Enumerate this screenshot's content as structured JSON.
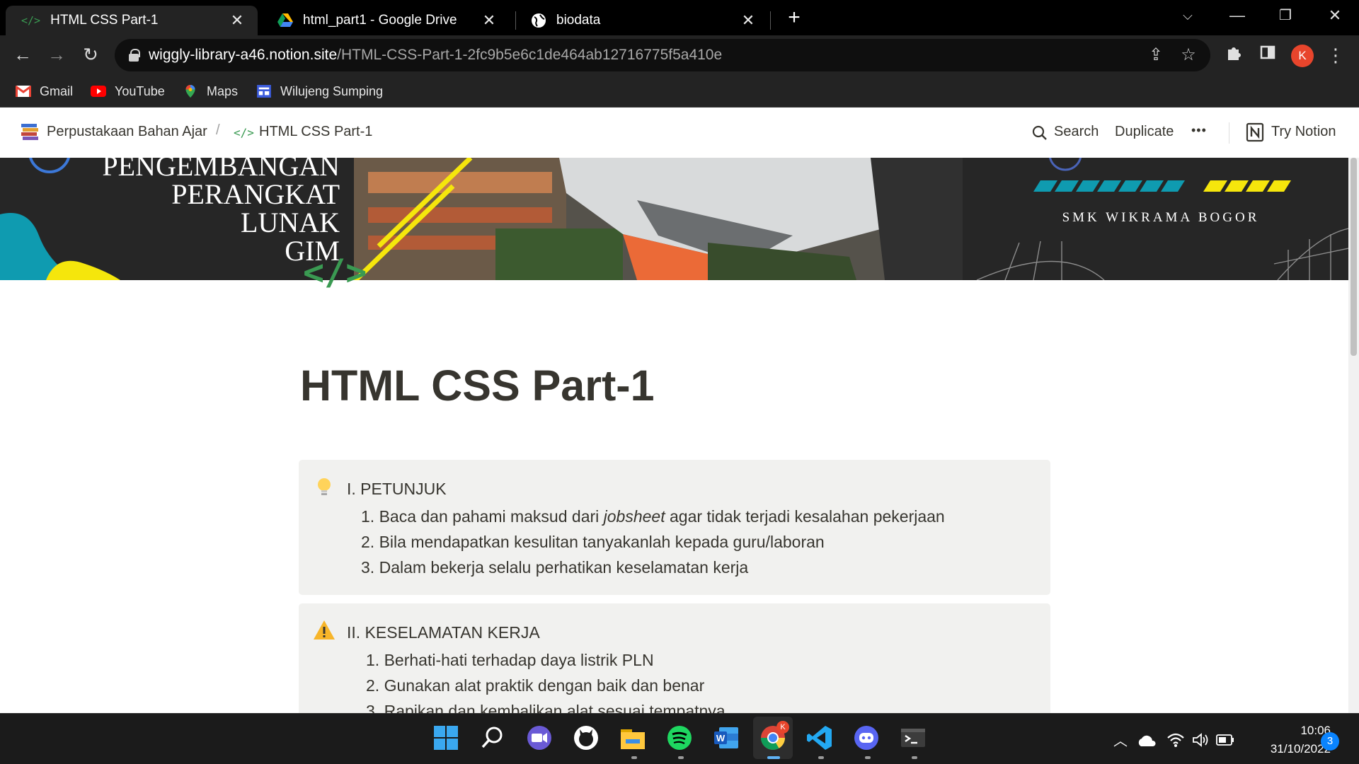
{
  "browser": {
    "tabs": [
      {
        "title": "HTML CSS Part-1",
        "icon": "code-tag-icon",
        "active": true
      },
      {
        "title": "html_part1 - Google Drive",
        "icon": "google-drive-icon",
        "active": false
      },
      {
        "title": "biodata",
        "icon": "globe-icon",
        "active": false
      }
    ],
    "url_host": "wiggly-library-a46.notion.site",
    "url_path": "/HTML-CSS-Part-1-2fc9b5e6c1de464ab12716775f5a410e",
    "profile_initial": "K",
    "bookmarks": [
      {
        "label": "Gmail",
        "icon": "gmail-icon"
      },
      {
        "label": "YouTube",
        "icon": "youtube-icon"
      },
      {
        "label": "Maps",
        "icon": "maps-icon"
      },
      {
        "label": "Wilujeng Sumping",
        "icon": "bookmark-site-icon"
      }
    ]
  },
  "notion": {
    "breadcrumb_parent": "Perpustakaan Bahan Ajar",
    "breadcrumb_separator": "/",
    "breadcrumb_current": "HTML CSS Part-1",
    "search_label": "Search",
    "duplicate_label": "Duplicate",
    "more_label": "•••",
    "try_label": "Try Notion"
  },
  "cover": {
    "left_text": [
      "PENGEMBANGAN",
      "PERANGKAT",
      "LUNAK",
      "GIM"
    ],
    "code_symbol": "</>",
    "right_text": "SMK WIKRAMA BOGOR"
  },
  "page": {
    "title": "HTML CSS Part-1",
    "callouts": [
      {
        "icon": "lightbulb-icon",
        "heading": "I. PETUNJUK",
        "items": [
          {
            "num": "1.",
            "before": "Baca dan pahami maksud dari ",
            "em": "jobsheet",
            "after": " agar tidak terjadi kesalahan pekerjaan"
          },
          {
            "num": "2.",
            "before": "Bila mendapatkan kesulitan tanyakanlah kepada guru/laboran",
            "em": "",
            "after": ""
          },
          {
            "num": "3.",
            "before": "Dalam bekerja selalu perhatikan keselamatan kerja",
            "em": "",
            "after": ""
          }
        ]
      },
      {
        "icon": "warning-icon",
        "heading": "II. KESELAMATAN KERJA",
        "items": [
          {
            "num": "1.",
            "before": "Berhati-hati terhadap daya listrik PLN",
            "em": "",
            "after": ""
          },
          {
            "num": "2.",
            "before": "Gunakan alat praktik dengan baik dan benar",
            "em": "",
            "after": ""
          },
          {
            "num": "3.",
            "before": "Rapikan dan kembalikan alat sesuai tempatnya",
            "em": "",
            "after": ""
          }
        ]
      }
    ]
  },
  "taskbar": {
    "time": "10:06",
    "date": "31/10/2022",
    "notification_count": "3",
    "chrome_badge": "K",
    "apps": [
      "windows-start-icon",
      "search-icon",
      "zoom-icon",
      "github-icon",
      "file-explorer-icon",
      "spotify-icon",
      "word-icon",
      "chrome-icon",
      "vscode-icon",
      "discord-icon",
      "terminal-icon"
    ]
  },
  "colors": {
    "accent_yellow": "#f5e60c",
    "accent_teal": "#0f9bb0",
    "code_green": "#3a9a52",
    "callout_bg": "#f1f1ef",
    "text": "#37352f"
  }
}
